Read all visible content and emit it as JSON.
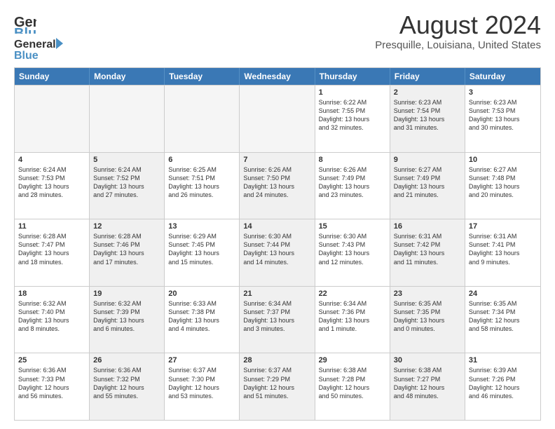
{
  "logo": {
    "line1": "General",
    "line2": "Blue"
  },
  "title": "August 2024",
  "subtitle": "Presquille, Louisiana, United States",
  "days": [
    "Sunday",
    "Monday",
    "Tuesday",
    "Wednesday",
    "Thursday",
    "Friday",
    "Saturday"
  ],
  "rows": [
    [
      {
        "day": "",
        "info": "",
        "shaded": true
      },
      {
        "day": "",
        "info": "",
        "shaded": true
      },
      {
        "day": "",
        "info": "",
        "shaded": true
      },
      {
        "day": "",
        "info": "",
        "shaded": true
      },
      {
        "day": "1",
        "info": "Sunrise: 6:22 AM\nSunset: 7:55 PM\nDaylight: 13 hours\nand 32 minutes."
      },
      {
        "day": "2",
        "info": "Sunrise: 6:23 AM\nSunset: 7:54 PM\nDaylight: 13 hours\nand 31 minutes.",
        "shaded": true
      },
      {
        "day": "3",
        "info": "Sunrise: 6:23 AM\nSunset: 7:53 PM\nDaylight: 13 hours\nand 30 minutes."
      }
    ],
    [
      {
        "day": "4",
        "info": "Sunrise: 6:24 AM\nSunset: 7:53 PM\nDaylight: 13 hours\nand 28 minutes."
      },
      {
        "day": "5",
        "info": "Sunrise: 6:24 AM\nSunset: 7:52 PM\nDaylight: 13 hours\nand 27 minutes.",
        "shaded": true
      },
      {
        "day": "6",
        "info": "Sunrise: 6:25 AM\nSunset: 7:51 PM\nDaylight: 13 hours\nand 26 minutes."
      },
      {
        "day": "7",
        "info": "Sunrise: 6:26 AM\nSunset: 7:50 PM\nDaylight: 13 hours\nand 24 minutes.",
        "shaded": true
      },
      {
        "day": "8",
        "info": "Sunrise: 6:26 AM\nSunset: 7:49 PM\nDaylight: 13 hours\nand 23 minutes."
      },
      {
        "day": "9",
        "info": "Sunrise: 6:27 AM\nSunset: 7:49 PM\nDaylight: 13 hours\nand 21 minutes.",
        "shaded": true
      },
      {
        "day": "10",
        "info": "Sunrise: 6:27 AM\nSunset: 7:48 PM\nDaylight: 13 hours\nand 20 minutes."
      }
    ],
    [
      {
        "day": "11",
        "info": "Sunrise: 6:28 AM\nSunset: 7:47 PM\nDaylight: 13 hours\nand 18 minutes."
      },
      {
        "day": "12",
        "info": "Sunrise: 6:28 AM\nSunset: 7:46 PM\nDaylight: 13 hours\nand 17 minutes.",
        "shaded": true
      },
      {
        "day": "13",
        "info": "Sunrise: 6:29 AM\nSunset: 7:45 PM\nDaylight: 13 hours\nand 15 minutes."
      },
      {
        "day": "14",
        "info": "Sunrise: 6:30 AM\nSunset: 7:44 PM\nDaylight: 13 hours\nand 14 minutes.",
        "shaded": true
      },
      {
        "day": "15",
        "info": "Sunrise: 6:30 AM\nSunset: 7:43 PM\nDaylight: 13 hours\nand 12 minutes."
      },
      {
        "day": "16",
        "info": "Sunrise: 6:31 AM\nSunset: 7:42 PM\nDaylight: 13 hours\nand 11 minutes.",
        "shaded": true
      },
      {
        "day": "17",
        "info": "Sunrise: 6:31 AM\nSunset: 7:41 PM\nDaylight: 13 hours\nand 9 minutes."
      }
    ],
    [
      {
        "day": "18",
        "info": "Sunrise: 6:32 AM\nSunset: 7:40 PM\nDaylight: 13 hours\nand 8 minutes."
      },
      {
        "day": "19",
        "info": "Sunrise: 6:32 AM\nSunset: 7:39 PM\nDaylight: 13 hours\nand 6 minutes.",
        "shaded": true
      },
      {
        "day": "20",
        "info": "Sunrise: 6:33 AM\nSunset: 7:38 PM\nDaylight: 13 hours\nand 4 minutes."
      },
      {
        "day": "21",
        "info": "Sunrise: 6:34 AM\nSunset: 7:37 PM\nDaylight: 13 hours\nand 3 minutes.",
        "shaded": true
      },
      {
        "day": "22",
        "info": "Sunrise: 6:34 AM\nSunset: 7:36 PM\nDaylight: 13 hours\nand 1 minute."
      },
      {
        "day": "23",
        "info": "Sunrise: 6:35 AM\nSunset: 7:35 PM\nDaylight: 13 hours\nand 0 minutes.",
        "shaded": true
      },
      {
        "day": "24",
        "info": "Sunrise: 6:35 AM\nSunset: 7:34 PM\nDaylight: 12 hours\nand 58 minutes."
      }
    ],
    [
      {
        "day": "25",
        "info": "Sunrise: 6:36 AM\nSunset: 7:33 PM\nDaylight: 12 hours\nand 56 minutes."
      },
      {
        "day": "26",
        "info": "Sunrise: 6:36 AM\nSunset: 7:32 PM\nDaylight: 12 hours\nand 55 minutes.",
        "shaded": true
      },
      {
        "day": "27",
        "info": "Sunrise: 6:37 AM\nSunset: 7:30 PM\nDaylight: 12 hours\nand 53 minutes."
      },
      {
        "day": "28",
        "info": "Sunrise: 6:37 AM\nSunset: 7:29 PM\nDaylight: 12 hours\nand 51 minutes.",
        "shaded": true
      },
      {
        "day": "29",
        "info": "Sunrise: 6:38 AM\nSunset: 7:28 PM\nDaylight: 12 hours\nand 50 minutes."
      },
      {
        "day": "30",
        "info": "Sunrise: 6:38 AM\nSunset: 7:27 PM\nDaylight: 12 hours\nand 48 minutes.",
        "shaded": true
      },
      {
        "day": "31",
        "info": "Sunrise: 6:39 AM\nSunset: 7:26 PM\nDaylight: 12 hours\nand 46 minutes."
      }
    ]
  ]
}
